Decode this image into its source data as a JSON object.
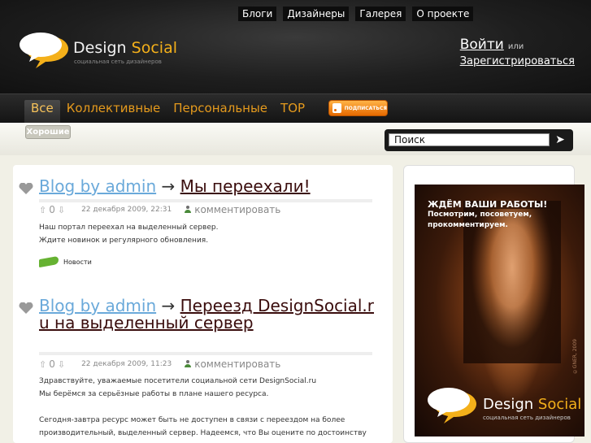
{
  "topnav": [
    "Блоги",
    "Дизайнеры",
    "Галерея",
    "О проекте"
  ],
  "logo": {
    "word1": "Design",
    "word2": "Social",
    "tagline": "социальная сеть дизайнеров"
  },
  "auth": {
    "login": "Войти",
    "or": "или",
    "register": "Зарегистрироваться"
  },
  "categories": [
    "Все",
    "Коллективные",
    "Персональные",
    "TOP"
  ],
  "subscribe": "ПОДПИСАТЬСЯ",
  "subtab": "Хорошие",
  "search": {
    "value": "Поиск",
    "button": "➤"
  },
  "posts": [
    {
      "author": "Blog by admin",
      "arrow": "→",
      "title": "Мы переехали!",
      "votes": "0",
      "date": "22 декабря 2009, 22:31",
      "comment": "комментировать",
      "body": [
        "Наш портал переехал на выделенный сервер.",
        "Ждите новинок и регулярного обновления."
      ],
      "tag": "Новости"
    },
    {
      "author": "Blog by admin",
      "arrow": "→",
      "title": "Переезд DesignSocial.ru на выделенный сервер",
      "votes": "0",
      "date": "22 декабря 2009, 11:23",
      "comment": "комментировать",
      "body": [
        "Здравствуйте, уважаемые посетители социальной сети DesignSocial.ru",
        "Мы берёмся за серьёзные работы в плане нашего ресурса.",
        "",
        "Сегодня-завтра ресурс может быть не доступен в связи с переездом на более",
        "производительный, выделенный сервер. Надеемся, что Вы оцените по достоинству"
      ]
    }
  ],
  "ad": {
    "line1": "ЖДЁМ ВАШИ РАБОТЫ!",
    "line2": "Посмотрим, посоветуем,",
    "line3": "прокомментируем.",
    "word1": "Design",
    "word2": "Social",
    "tagline": "социальная сеть дизайнеров",
    "signature": "©GNER, 2009"
  },
  "colors": {
    "accent": "#f4b01a",
    "link": "#6aa9da",
    "title": "#3a0d0d",
    "category": "#e59a1d"
  }
}
